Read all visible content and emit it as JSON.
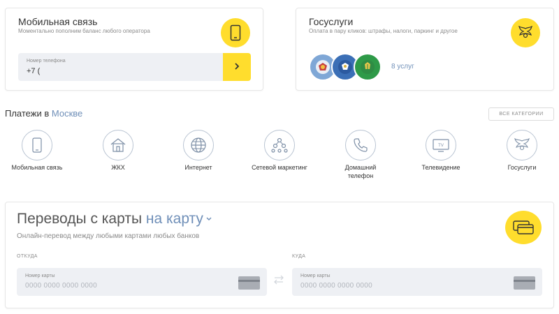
{
  "mobile": {
    "title": "Мобильная связь",
    "subtitle": "Моментально пополним баланс любого оператора",
    "field_label": "Номер телефона",
    "field_value": "+7 (",
    "go_icon": "chevron-right-icon"
  },
  "gos": {
    "title": "Госуслуги",
    "subtitle": "Оплата в пару кликов: штрафы, налоги, паркинг и другое",
    "services_count": "8 услуг",
    "badges": [
      "gibdd-emblem",
      "fns-emblem",
      "fssp-emblem"
    ]
  },
  "payments": {
    "title_prefix": "Платежи в",
    "city": "Москве",
    "all_categories": "ВСЕ КАТЕГОРИИ",
    "categories": [
      {
        "label": "Мобильная связь",
        "icon": "smartphone-icon"
      },
      {
        "label": "ЖКХ",
        "icon": "house-icon"
      },
      {
        "label": "Интернет",
        "icon": "globe-icon"
      },
      {
        "label": "Сетевой маркетинг",
        "icon": "network-icon"
      },
      {
        "label": "Домашний телефон",
        "icon": "phone-handset-icon"
      },
      {
        "label": "Телевидение",
        "icon": "tv-icon"
      },
      {
        "label": "Госуслуги",
        "icon": "eagle-icon"
      }
    ]
  },
  "transfers": {
    "title": "Переводы с карты",
    "title_accent": "на карту",
    "subtitle": "Онлайн-перевод между любыми картами любых банков",
    "from_label": "ОТКУДА",
    "to_label": "КУДА",
    "from_field_label": "Номер карты",
    "from_placeholder": "0000 0000 0000 0000",
    "to_field_label": "Номер карты",
    "to_placeholder": "0000 0000 0000 0000"
  },
  "colors": {
    "accent_yellow": "#ffdd2d",
    "link_blue": "#6f8fb8",
    "field_bg": "#eef0f4"
  }
}
